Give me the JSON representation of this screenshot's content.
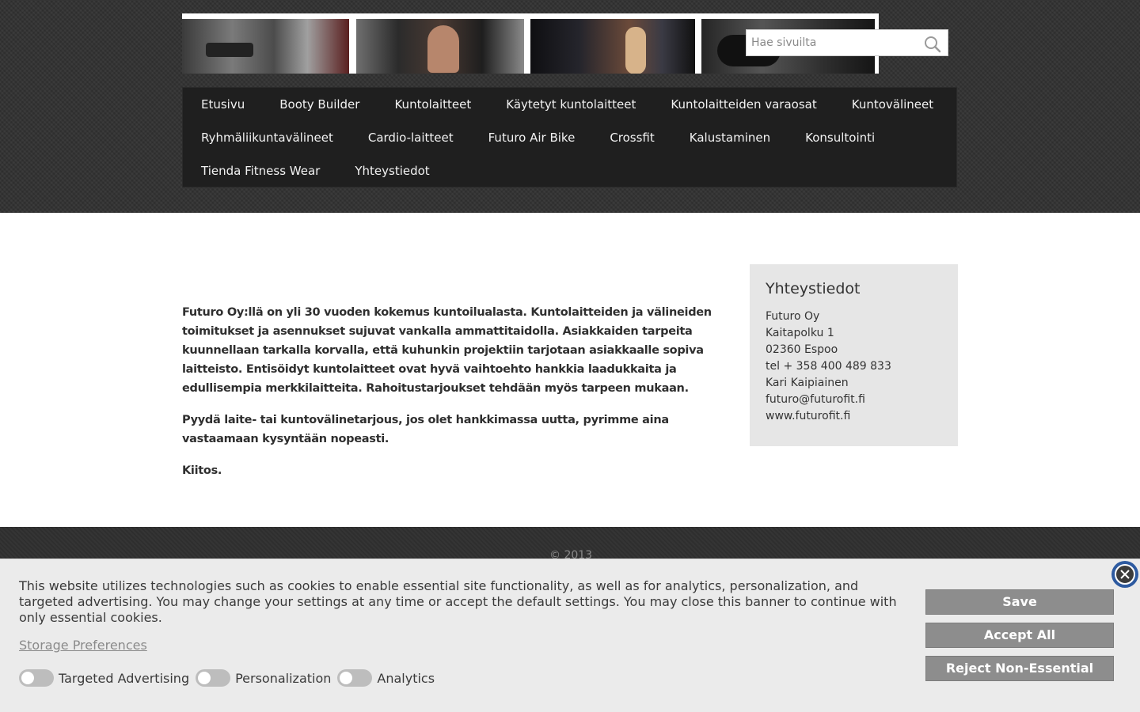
{
  "search": {
    "placeholder": "Hae sivuilta"
  },
  "nav": {
    "items": [
      "Etusivu",
      "Booty Builder",
      "Kuntolaitteet",
      "Käytetyt kuntolaitteet",
      "Kuntolaitteiden varaosat",
      "Kuntovälineet",
      "Ryhmäliikuntavälineet",
      "Cardio-laitteet",
      "Futuro Air Bike",
      "Crossfit",
      "Kalustaminen",
      "Konsultointi",
      "Tienda Fitness Wear",
      "Yhteystiedot"
    ]
  },
  "content": {
    "paragraphs": [
      "Futuro Oy:llä on yli 30 vuoden kokemus kuntoilualasta. Kuntolaitteiden ja välineiden toimitukset ja asennukset sujuvat vankalla ammattitaidolla. Asiakkaiden tarpeita kuunnellaan tarkalla korvalla, että kuhunkin projektiin tarjotaan asiakkaalle sopiva laitteisto. Entisöidyt kuntolaitteet ovat hyvä vaihtoehto hankkia laadukkaita ja edullisempia merkkilaitteita. Rahoitustarjoukset tehdään myös tarpeen mukaan.",
      "Pyydä laite- tai kuntovälinetarjous, jos olet hankkimassa uutta, pyrimme aina vastaamaan kysyntään nopeasti.",
      "Kiitos."
    ]
  },
  "sidebar": {
    "title": "Yhteystiedot",
    "lines": [
      "Futuro Oy",
      "Kaitapolku 1",
      "02360 Espoo",
      "tel + 358 400 489 833",
      "Kari Kaipiainen",
      "futuro@futurofit.fi",
      "www.futurofit.fi"
    ]
  },
  "footer": {
    "copyright": "© 2013"
  },
  "cookie": {
    "message": "This website utilizes technologies such as cookies to enable essential site functionality, as well as for analytics, personalization, and targeted advertising. You may change your settings at any time or accept the default settings. You may close this banner to continue with only essential cookies.",
    "preferences_link": "Storage Preferences",
    "toggles": [
      "Targeted Advertising",
      "Personalization",
      "Analytics"
    ],
    "buttons": {
      "save": "Save",
      "accept": "Accept All",
      "reject": "Reject Non-Essential"
    }
  },
  "icons": {
    "search": "search-icon",
    "close": "close-icon"
  }
}
